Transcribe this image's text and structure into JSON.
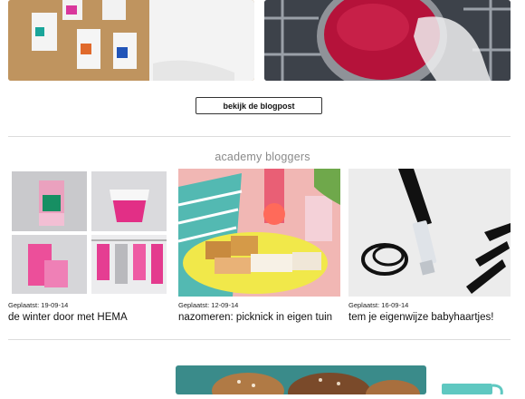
{
  "blogpost_button": {
    "label": "bekijk de blogpost"
  },
  "section": {
    "title": "academy bloggers"
  },
  "posts": [
    {
      "date": "Geplaatst: 19-09-14",
      "title": "de winter door met HEMA"
    },
    {
      "date": "Geplaatst: 12-09-14",
      "title": "nazomeren: picknick in eigen tuin"
    },
    {
      "date": "Geplaatst: 16-09-14",
      "title": "tem je eigenwijze babyhaartjes!"
    }
  ],
  "colors": {
    "accent_pink": "#e8368f",
    "divider": "#dcdcdc",
    "section_title": "#8a8a8a"
  }
}
